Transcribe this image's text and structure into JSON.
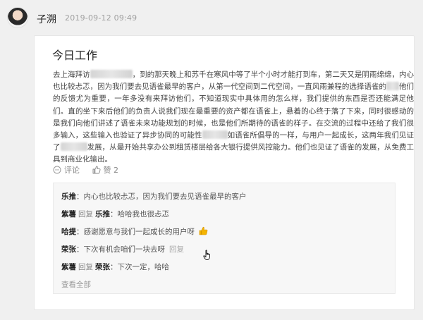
{
  "post": {
    "author": "子溯",
    "timestamp": "2019-09-12 09:49"
  },
  "card": {
    "title": "今日工作",
    "body": {
      "p1a": "去上海拜访",
      "p1b": "，到的那天晚上和苏千在寒风中等了半个小时才能打到车，第二天又是阴雨绵绵，内心也比较忐忑，因为我们要去见语雀最早的客户，从第一代空间到二代空间，一直风雨兼程的选择语雀的",
      "p1c": "他们的反馈尤为重要，一年多没有来拜访他们，不知道现实中具体用的怎么样，我们提供的东西是否还能满足他们。直的坐下来后他们的负责人说我们现在最重要的资产都在语雀上，悬着的心终于落了下来，同时很感动的是我们向他们讲述了语雀未来功能规划的时候，也是他们所期待的语雀的样子。在交流的过程中还给了我们很多输入，这些输入也验证了异步协同的可能性",
      "p1d": "如语雀所倡导的一样，与用户一起成长，这两年我们见证了",
      "p1e": "发展，从最开始共享办公到租赁楼层给各大银行提供风控能力。他们也见证了语雀的发展，从免费工具到商业化输出。"
    },
    "actions": {
      "comment_label": "评论",
      "like_label": "赞 2"
    },
    "comments": [
      {
        "name": "乐推",
        "separator": "：",
        "text": "内心也比较忐忑，因为我们要去见语雀最早的客户"
      },
      {
        "name": "紫薯",
        "reply_word": "回复",
        "target": "乐推",
        "separator": "：",
        "text": "哈哈我也很忐忑"
      },
      {
        "name": "哈提",
        "separator": "：",
        "text": "感谢愿意与我们一起成长的用户呀"
      },
      {
        "name": "荣张",
        "separator": "：",
        "text": "下次有机会咱们一块去呀",
        "reply_link": "回复"
      },
      {
        "name": "紫薯",
        "reply_word": "回复",
        "target": "荣张",
        "separator": "：",
        "text": "下次一定，哈哈"
      }
    ],
    "view_all": "查看全部"
  },
  "icons": {
    "comment": "comment-bubble-icon",
    "like": "thumbs-up-icon",
    "emoji": "thumbs-up-emoji",
    "cursor": "hand-cursor-icon"
  },
  "colors": {
    "background": "#f0f0f0",
    "card": "#ffffff",
    "comment_box": "#f7f7f7",
    "emoji": "#f4b400"
  }
}
